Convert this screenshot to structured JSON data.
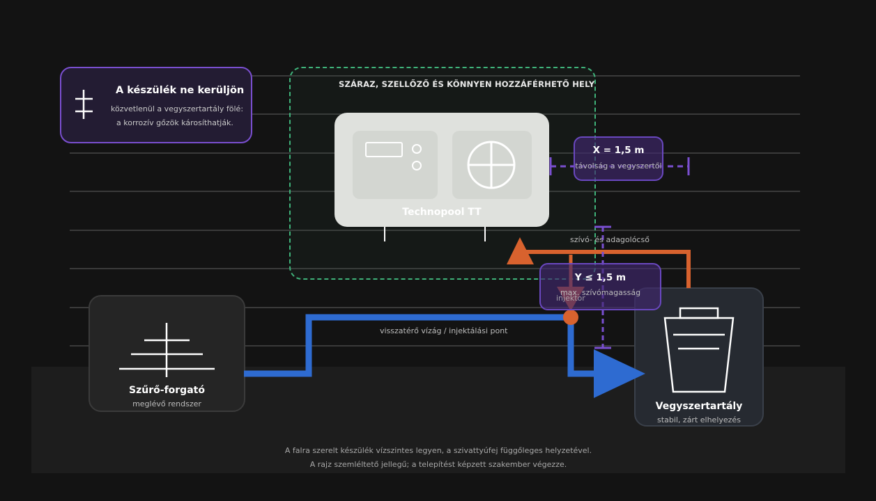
{
  "zone": {
    "title": "SZÁRAZ, SZELLŐZŐ ÉS KÖNNYEN HOZZÁFÉRHETŐ HELY"
  },
  "note": {
    "icon": "cross-bar-icon",
    "title": "A készülék ne kerüljön",
    "line1": "közvetlenül a vegyszertartály fölé:",
    "line2": "a korrozív gőzök károsíthatják."
  },
  "device": {
    "label": "Technopool TT"
  },
  "distance_x": {
    "title": "X = 1,5 m",
    "subtitle": "távolság a vegyszertől"
  },
  "distance_y": {
    "title": "Y ≤ 1,5 m",
    "subtitle": "max. szívómagasság"
  },
  "labels": {
    "suction_hose": "szívó- és adagolócső",
    "injector": "injektor",
    "return_pipe": "visszatérő vízág / injektálási pont"
  },
  "filter": {
    "title": "Szűrő-forgató",
    "subtitle": "meglévő rendszer"
  },
  "tank": {
    "title": "Vegyszertartály",
    "subtitle": "stabil, zárt elhelyezés"
  },
  "footer": {
    "line1": "A falra szerelt készülék vízszintes legyen, a szivattyúfej függőleges helyzetével.",
    "line2": "A rajz szemléltető jellegű; a telepítést képzett szakember végezze."
  },
  "colors": {
    "zone_border": "#3fb37a",
    "measure": "#7a4fd0",
    "pipe_blue": "#2e6bd1",
    "hose_orange": "#d8622e"
  }
}
